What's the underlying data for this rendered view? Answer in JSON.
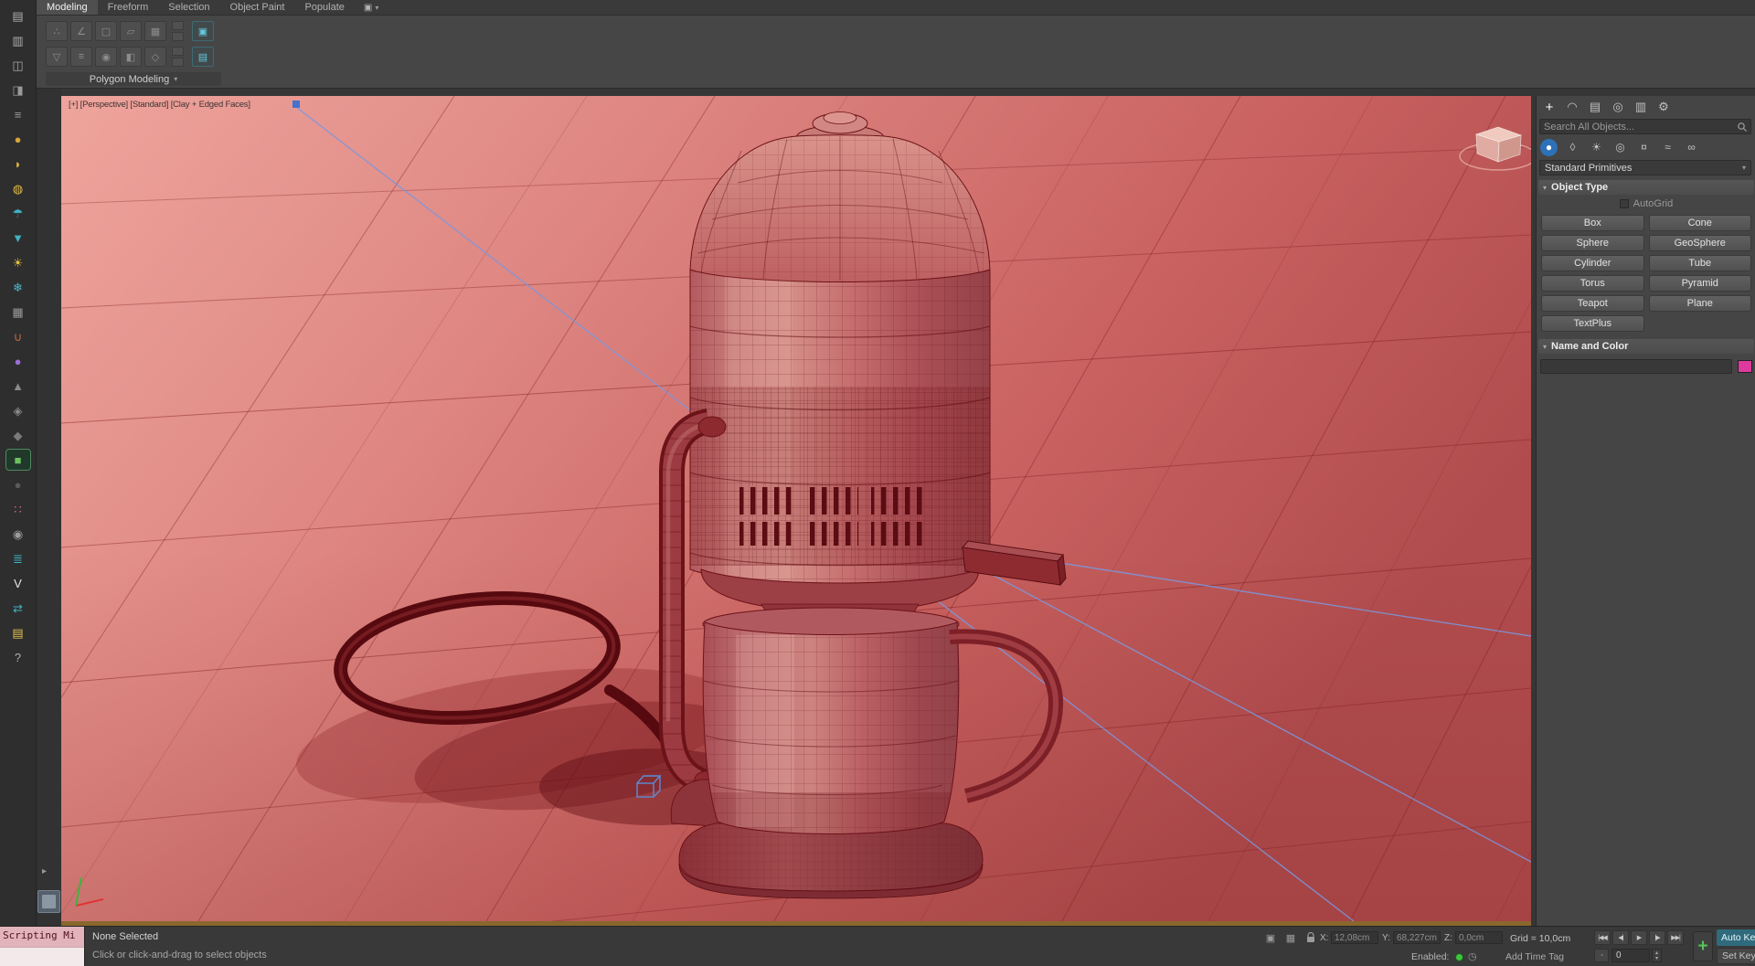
{
  "ribbon": {
    "tabs": [
      {
        "name": "tab-modeling",
        "label": "Modeling",
        "active": true
      },
      {
        "name": "tab-freeform",
        "label": "Freeform",
        "active": false
      },
      {
        "name": "tab-selection",
        "label": "Selection",
        "active": false
      },
      {
        "name": "tab-object-paint",
        "label": "Object Paint",
        "active": false
      },
      {
        "name": "tab-populate",
        "label": "Populate",
        "active": false
      }
    ],
    "menu_icon": "▣",
    "menu_caret": "▾",
    "panel_label": "Polygon Modeling",
    "panel_caret": "▾",
    "tools_row1": [
      {
        "name": "vertex-mode-button",
        "glyph": "∴"
      },
      {
        "name": "edge-mode-button",
        "glyph": "∠"
      },
      {
        "name": "border-mode-button",
        "glyph": "▢"
      },
      {
        "name": "polygon-mode-button",
        "glyph": "▱"
      },
      {
        "name": "element-mode-button",
        "glyph": "▦"
      }
    ],
    "tools_row2": [
      {
        "name": "pin-stack-button",
        "glyph": "▽"
      },
      {
        "name": "show-end-result-button",
        "glyph": "≡"
      },
      {
        "name": "use-soft-selection-button",
        "glyph": "◉"
      },
      {
        "name": "shaded-faces-button",
        "glyph": "◧"
      },
      {
        "name": "preview-subobjects-button",
        "glyph": "◇"
      }
    ],
    "tools_accent": [
      {
        "name": "edit-poly-mode-button",
        "glyph": "▣"
      },
      {
        "name": "collapse-stack-button",
        "glyph": "▤"
      }
    ]
  },
  "left_toolbar": {
    "icons": [
      {
        "name": "scene-explorer-icon",
        "glyph": "▤",
        "color": "#b0b0b0"
      },
      {
        "name": "layer-manager-icon",
        "glyph": "▥",
        "color": "#b0b0b0"
      },
      {
        "name": "toolbar-dock-icon",
        "glyph": "◫",
        "color": "#a8a8a8"
      },
      {
        "name": "mirror-tool-icon",
        "glyph": "◨",
        "color": "#9a9a9a"
      },
      {
        "name": "align-tool-icon",
        "glyph": "≡",
        "color": "#9a9a9a"
      },
      {
        "name": "material-editor-icon",
        "glyph": "●",
        "color": "#d9a43a"
      },
      {
        "name": "render-setup-icon",
        "glyph": "◗",
        "color": "#e0b23e"
      },
      {
        "name": "rendered-frame-icon",
        "glyph": "◍",
        "color": "#e3bb4a"
      },
      {
        "name": "environment-icon",
        "glyph": "☂",
        "color": "#3fb3c4"
      },
      {
        "name": "effects-icon",
        "glyph": "▼",
        "color": "#3fb3c4"
      },
      {
        "name": "light-lister-icon",
        "glyph": "☀",
        "color": "#e8c33e"
      },
      {
        "name": "snowflake-icon",
        "glyph": "❄",
        "color": "#49b8c8"
      },
      {
        "name": "grid-snap-icon",
        "glyph": "▦",
        "color": "#9a9a9a"
      },
      {
        "name": "magnet-snap-icon",
        "glyph": "∪",
        "color": "#c86a3a"
      },
      {
        "name": "sphere-tool-icon",
        "glyph": "●",
        "color": "#9b6fd4"
      },
      {
        "name": "cone-tool-icon",
        "glyph": "▲",
        "color": "#8a8a8a"
      },
      {
        "name": "shapes-tool-icon",
        "glyph": "◈",
        "color": "#8a8a8a"
      },
      {
        "name": "compound-tool-icon",
        "glyph": "◆",
        "color": "#7a7a7a"
      },
      {
        "name": "isolate-mode-icon",
        "glyph": "■",
        "color": "#6fbf5f",
        "active": true
      },
      {
        "name": "dark-sphere-icon",
        "glyph": "●",
        "color": "#5a5a5a"
      },
      {
        "name": "particles-icon",
        "glyph": "∷",
        "color": "#d46a9a"
      },
      {
        "name": "camera-tool-icon",
        "glyph": "◉",
        "color": "#9a9a9a"
      },
      {
        "name": "layers-icon",
        "glyph": "≣",
        "color": "#3fb3c4"
      },
      {
        "name": "vray-toolbar-icon",
        "glyph": "V",
        "color": "#e8e8e8"
      },
      {
        "name": "swap-arrows-icon",
        "glyph": "⇄",
        "color": "#3fb3c4"
      },
      {
        "name": "notes-icon",
        "glyph": "▤",
        "color": "#e0c050"
      },
      {
        "name": "help-icon",
        "glyph": "?",
        "color": "#b0b0b0"
      }
    ]
  },
  "viewport": {
    "label": "[+] [Perspective] [Standard] [Clay + Edged Faces]"
  },
  "command_panel": {
    "tabs": [
      {
        "name": "create-tab",
        "glyph": "+",
        "active": true
      },
      {
        "name": "modify-tab",
        "glyph": "◠",
        "active": false
      },
      {
        "name": "hierarchy-tab",
        "glyph": "▤",
        "active": false
      },
      {
        "name": "motion-tab",
        "glyph": "◎",
        "active": false
      },
      {
        "name": "display-tab",
        "glyph": "▥",
        "active": false
      },
      {
        "name": "utilities-tab",
        "glyph": "⚙",
        "active": false
      }
    ],
    "search_placeholder": "Search All Objects...",
    "categories": [
      {
        "name": "geometry-category",
        "glyph": "●",
        "active": true
      },
      {
        "name": "shapes-category",
        "glyph": "◊",
        "active": false
      },
      {
        "name": "lights-category",
        "glyph": "☀",
        "active": false
      },
      {
        "name": "cameras-category",
        "glyph": "◎",
        "active": false
      },
      {
        "name": "helpers-category",
        "glyph": "¤",
        "active": false
      },
      {
        "name": "space-warps-category",
        "glyph": "≈",
        "active": false
      },
      {
        "name": "systems-category",
        "glyph": "∞",
        "active": false
      }
    ],
    "subcategory": "Standard Primitives",
    "object_type": {
      "title": "Object Type",
      "autogrid_label": "AutoGrid",
      "buttons": [
        {
          "name": "box-button",
          "label": "Box"
        },
        {
          "name": "cone-button",
          "label": "Cone"
        },
        {
          "name": "sphere-button",
          "label": "Sphere"
        },
        {
          "name": "geosphere-button",
          "label": "GeoSphere"
        },
        {
          "name": "cylinder-button",
          "label": "Cylinder"
        },
        {
          "name": "tube-button",
          "label": "Tube"
        },
        {
          "name": "torus-button",
          "label": "Torus"
        },
        {
          "name": "pyramid-button",
          "label": "Pyramid"
        },
        {
          "name": "teapot-button",
          "label": "Teapot"
        },
        {
          "name": "plane-button",
          "label": "Plane"
        },
        {
          "name": "textplus-button",
          "label": "TextPlus"
        }
      ]
    },
    "name_color": {
      "title": "Name and Color",
      "swatch_color": "#de3a9e"
    }
  },
  "status_bar": {
    "listener_text": "Scripting Mi",
    "selection_status": "None Selected",
    "prompt": "Click or click-and-drag to select objects",
    "status_icons": [
      {
        "name": "isolate-selection-button",
        "glyph": "▣"
      },
      {
        "name": "snaps-toggle-button",
        "glyph": "▦"
      }
    ],
    "x_label": "X:",
    "x_value": "12,08cm",
    "y_label": "Y:",
    "y_value": "68,227cm",
    "z_label": "Z:",
    "z_value": "0,0cm",
    "grid_text": "Grid = 10,0cm",
    "add_time_tag": "Add Time Tag",
    "enabled_label": "Enabled:",
    "led_color": "#3ec43e",
    "enabled_icon": "◷",
    "key_mode_glyph": "◦",
    "frame_value": "0",
    "auto_key_label": "Auto Key",
    "set_key_label": "Set Key",
    "playback": [
      {
        "name": "go-to-start-button",
        "glyph": "|◀◀"
      },
      {
        "name": "previous-frame-button",
        "glyph": "◀|"
      },
      {
        "name": "play-button",
        "glyph": "▶"
      },
      {
        "name": "next-frame-button",
        "glyph": "|▶"
      },
      {
        "name": "go-to-end-button",
        "glyph": "▶▶|"
      }
    ]
  },
  "misc": {
    "caret": "▾",
    "rollout_arrow": "▾",
    "expand_arrow": "▸",
    "spin_up": "▴",
    "spin_down": "▾",
    "plus": "+"
  }
}
